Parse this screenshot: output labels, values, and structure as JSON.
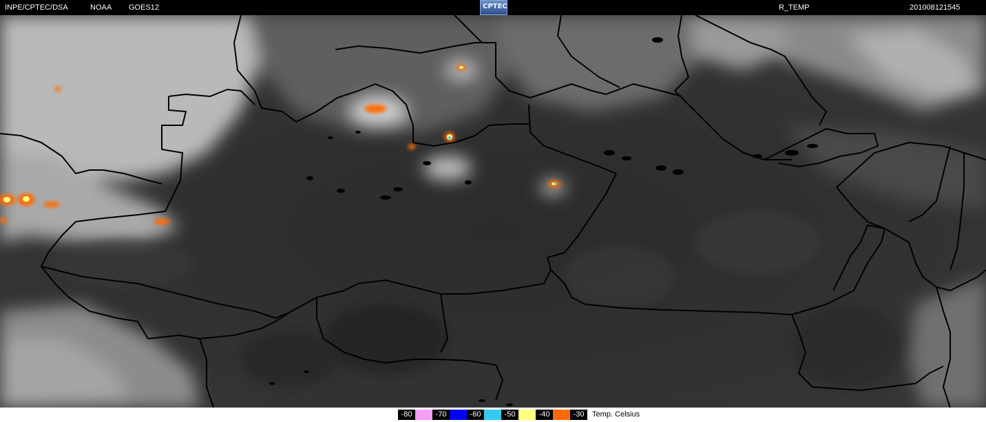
{
  "header": {
    "source": "INPE/CPTEC/DSA",
    "agency": "NOAA",
    "satellite": "GOES12",
    "logo_text": "CPTEC",
    "product": "R_TEMP",
    "timestamp": "201008121545"
  },
  "legend": {
    "entries": [
      {
        "label": "-80",
        "color": "#f49ef4"
      },
      {
        "label": "-70",
        "color": "#0000ff"
      },
      {
        "label": "-60",
        "color": "#33ccf0"
      },
      {
        "label": "-50",
        "color": "#ffff80"
      },
      {
        "label": "-40",
        "color": "#ff6a00"
      },
      {
        "label": "-30",
        "color": ""
      }
    ],
    "unit": "Temp. Celsius"
  },
  "colors": {
    "map_background": "#2f2f2f",
    "cloud": "#c8c8c8",
    "borders": "#000000"
  }
}
